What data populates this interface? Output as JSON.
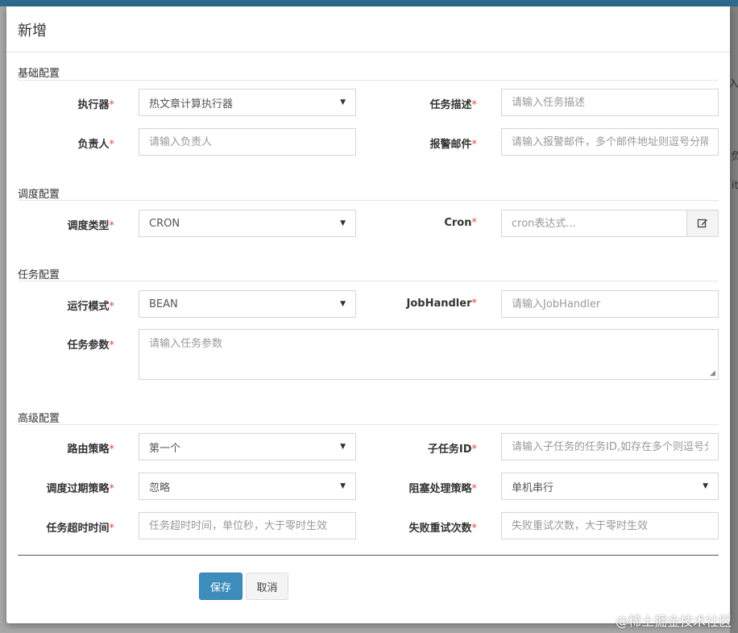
{
  "modal": {
    "title": "新增"
  },
  "sections": {
    "basic": "基础配置",
    "schedule": "调度配置",
    "job": "任务配置",
    "advanced": "高级配置"
  },
  "fields": {
    "executor": {
      "label": "执行器",
      "required": "*",
      "value": "热文章计算执行器"
    },
    "job_desc": {
      "label": "任务描述",
      "required": "*",
      "placeholder": "请输入任务描述"
    },
    "author": {
      "label": "负责人",
      "required": "*",
      "placeholder": "请输入负责人"
    },
    "alarm_email": {
      "label": "报警邮件",
      "required": "*",
      "placeholder": "请输入报警邮件，多个邮件地址则逗号分隔"
    },
    "schedule_type": {
      "label": "调度类型",
      "required": "*",
      "value": "CRON"
    },
    "cron": {
      "label": "Cron",
      "required": "*",
      "placeholder": "cron表达式..."
    },
    "glue_type": {
      "label": "运行模式",
      "required": "*",
      "value": "BEAN"
    },
    "job_handler": {
      "label": "JobHandler",
      "required": "*",
      "placeholder": "请输入JobHandler"
    },
    "job_param": {
      "label": "任务参数",
      "required": "*",
      "placeholder": "请输入任务参数"
    },
    "route_strategy": {
      "label": "路由策略",
      "required": "*",
      "value": "第一个"
    },
    "child_job_id": {
      "label": "子任务ID",
      "required": "*",
      "placeholder": "请输入子任务的任务ID,如存在多个则逗号分隔"
    },
    "misfire_strategy": {
      "label": "调度过期策略",
      "required": "*",
      "value": "忽略"
    },
    "block_strategy": {
      "label": "阻塞处理策略",
      "required": "*",
      "value": "单机串行"
    },
    "timeout": {
      "label": "任务超时时间",
      "required": "*",
      "placeholder": "任务超时时间，单位秒，大于零时生效"
    },
    "fail_retry": {
      "label": "失败重试次数",
      "required": "*",
      "placeholder": "失败重试次数，大于零时生效"
    }
  },
  "buttons": {
    "save": "保存",
    "cancel": "取消"
  },
  "icons": {
    "caret": "caret-down-icon",
    "edit": "edit-icon",
    "grip": "resize-grip-icon"
  },
  "background": {
    "frag1": "入",
    "frag2": "负",
    "frag3": "it"
  },
  "watermark": "@稀土掘金技术社区",
  "colors": {
    "primary": "#3c8dbc",
    "required": "#dd4b39",
    "topbar": "#2e6a8e"
  }
}
